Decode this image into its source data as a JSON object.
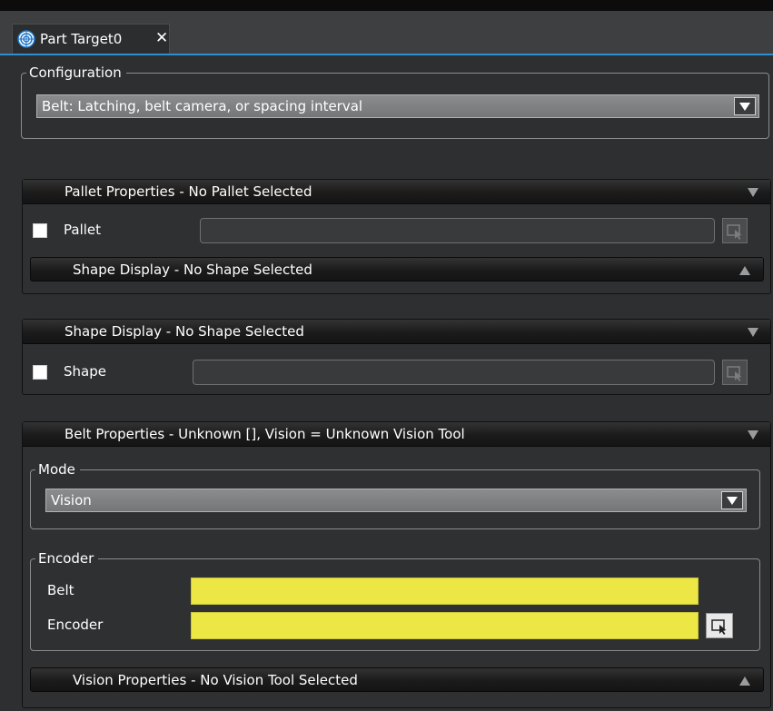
{
  "tab": {
    "label": "Part Target0",
    "close": "✕"
  },
  "configuration": {
    "legend": "Configuration",
    "selected": "Belt: Latching, belt camera, or spacing interval"
  },
  "pallet_panel": {
    "header": "Pallet Properties - No Pallet Selected",
    "checkbox_label": "Pallet",
    "sub_header": "Shape Display - No Shape Selected"
  },
  "shape_panel": {
    "header": "Shape Display - No Shape Selected",
    "checkbox_label": "Shape"
  },
  "belt_panel": {
    "header": "Belt Properties -  Unknown [], Vision = Unknown Vision Tool",
    "mode_legend": "Mode",
    "mode_selected": "Vision",
    "encoder_legend": "Encoder",
    "belt_label": "Belt",
    "encoder_label": "Encoder",
    "sub_header": "Vision Properties - No Vision Tool Selected"
  },
  "colors": {
    "accent": "#2d8fd0",
    "required_field": "#ece745"
  }
}
